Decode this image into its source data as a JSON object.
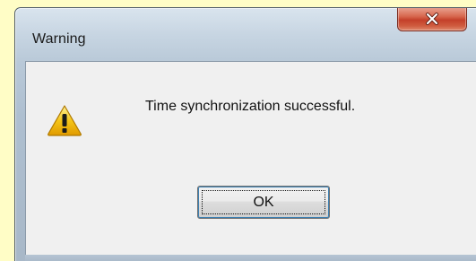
{
  "window": {
    "title": "Warning",
    "close_icon": "close-icon"
  },
  "dialog": {
    "icon": "warning-icon",
    "message": "Time synchronization successful."
  },
  "buttons": {
    "ok_label": "OK"
  },
  "colors": {
    "background": "#fffdc6",
    "close_button": "#c4402a",
    "client_area": "#f0f0f0",
    "warning_yellow": "#f5c518"
  }
}
